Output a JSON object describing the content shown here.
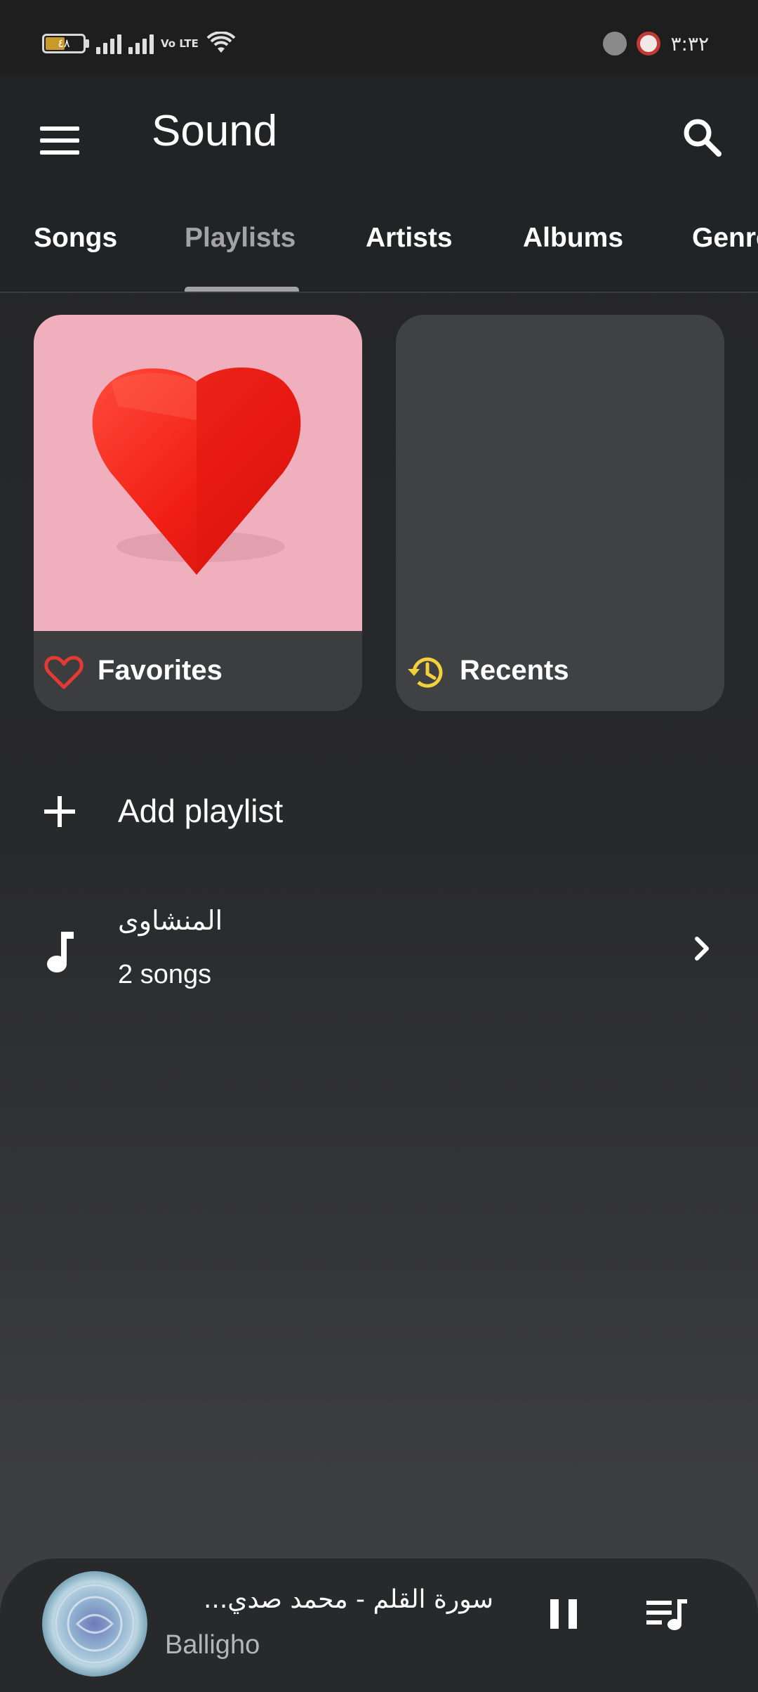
{
  "status_bar": {
    "battery_level": "٤٨",
    "battery_fraction": 0.48,
    "network_label": "Vo LTE",
    "time": "٣:٣٢",
    "icons": [
      "battery-icon",
      "signal-icon",
      "volte-icon",
      "wifi-icon",
      "notification-icon",
      "app-notification-icon"
    ]
  },
  "app_bar": {
    "title": "Sound",
    "menu_icon": "hamburger-menu-icon",
    "search_icon": "search-icon"
  },
  "tabs": [
    {
      "label": "Songs",
      "active": false
    },
    {
      "label": "Playlists",
      "active": true
    },
    {
      "label": "Artists",
      "active": false
    },
    {
      "label": "Albums",
      "active": false
    },
    {
      "label": "Genre",
      "active": false
    }
  ],
  "cards": [
    {
      "label": "Favorites",
      "icon": "heart-outline-icon",
      "icon_color": "#e53935"
    },
    {
      "label": "Recents",
      "icon": "history-icon",
      "icon_color": "#f2d13d"
    }
  ],
  "add_playlist": {
    "label": "Add playlist",
    "icon": "plus-icon"
  },
  "playlists": [
    {
      "title": "المنشاوى",
      "subtitle": "2 songs",
      "icon": "music-note-icon"
    }
  ],
  "mini_player": {
    "title": "سورة القلم - محمد صدي...",
    "artist": "Balligho",
    "pause_icon": "pause-icon",
    "queue_icon": "queue-music-icon"
  },
  "colors": {
    "background": "#242527",
    "app_bar": "#222325",
    "accent_pink": "#f0afbd",
    "heart_red": "#e53935",
    "recents_yellow": "#f2d13d",
    "inactive_tab": "#a3a3a5"
  }
}
